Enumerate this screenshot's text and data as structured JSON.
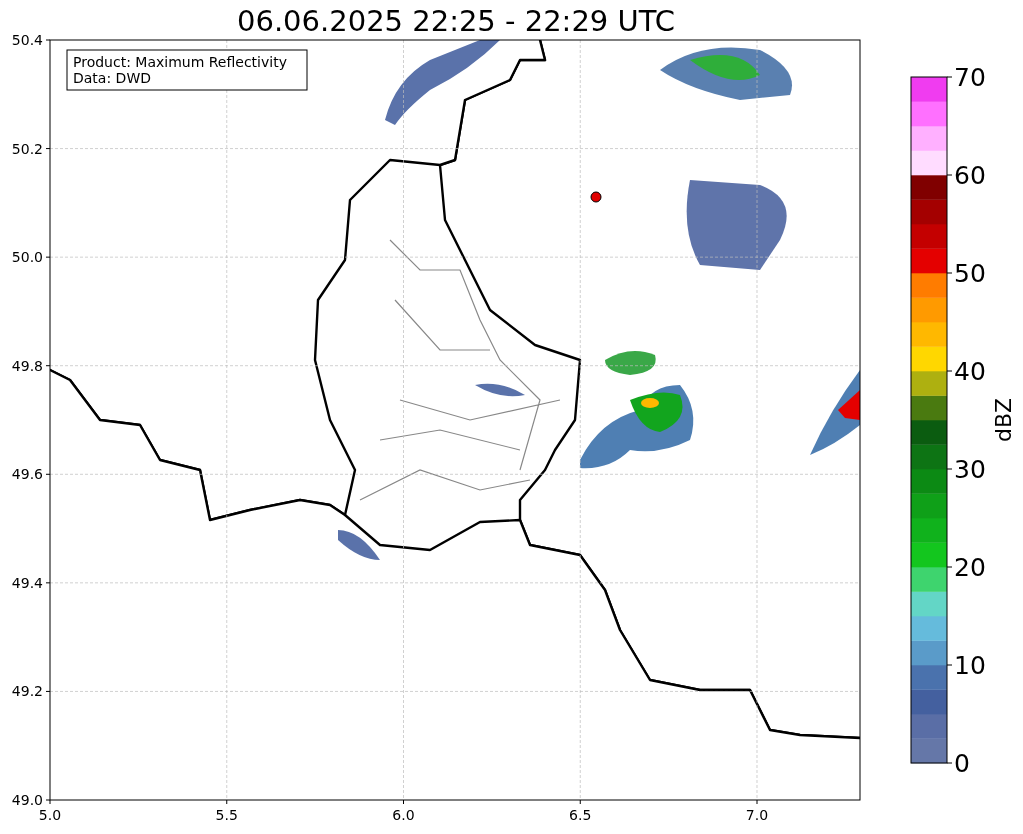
{
  "title": "06.06.2025 22:25 - 22:29 UTC",
  "info_box": [
    "Product: Maximum Reflectivity",
    "Data: DWD"
  ],
  "x_axis": {
    "ticks": [
      "5.0",
      "5.5",
      "6.0",
      "6.5",
      "7.0"
    ]
  },
  "y_axis": {
    "ticks": [
      "50.4",
      "50.2",
      "50.0",
      "49.8",
      "49.6",
      "49.4",
      "49.2",
      "49.0"
    ]
  },
  "colorbar": {
    "label": "dBZ",
    "ticks": [
      "70",
      "60",
      "50",
      "40",
      "30",
      "20",
      "10",
      "0"
    ],
    "bands": [
      {
        "color": "#6577a8"
      },
      {
        "color": "#5a6ea6"
      },
      {
        "color": "#44609f"
      },
      {
        "color": "#4a72ad"
      },
      {
        "color": "#5a9bc9"
      },
      {
        "color": "#65bbdc"
      },
      {
        "color": "#63d6c6"
      },
      {
        "color": "#3ed46e"
      },
      {
        "color": "#13c61e"
      },
      {
        "color": "#10b21c"
      },
      {
        "color": "#0fa018"
      },
      {
        "color": "#0c8a14"
      },
      {
        "color": "#0d7414"
      },
      {
        "color": "#0b5c10"
      },
      {
        "color": "#4a7a10"
      },
      {
        "color": "#aeb010"
      },
      {
        "color": "#ffd700"
      },
      {
        "color": "#ffb800"
      },
      {
        "color": "#ff9a00"
      },
      {
        "color": "#ff7c00"
      },
      {
        "color": "#e40000"
      },
      {
        "color": "#c40000"
      },
      {
        "color": "#a40000"
      },
      {
        "color": "#800000"
      },
      {
        "color": "#ffdcff"
      },
      {
        "color": "#ffb0ff"
      },
      {
        "color": "#ff70ff"
      },
      {
        "color": "#f03cf0"
      }
    ]
  }
}
